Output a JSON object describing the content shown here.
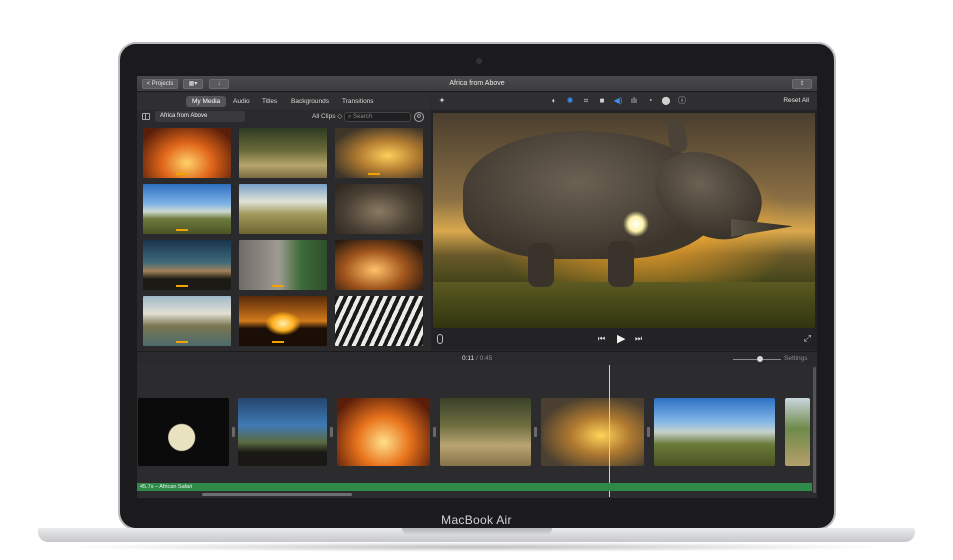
{
  "device": {
    "model_label": "MacBook Air"
  },
  "window": {
    "title": "Africa from Above",
    "projects_button": "< Projects",
    "layout_icon": "layout-icon",
    "import_icon": "import-arrow-icon",
    "share_icon": "share-icon"
  },
  "browser": {
    "tabs": [
      "My Media",
      "Audio",
      "Titles",
      "Backgrounds",
      "Transitions"
    ],
    "active_tab": "My Media",
    "event_name": "Africa from Above",
    "clip_filter": "All Clips ◇",
    "search_placeholder": "Search",
    "thumbnails": [
      "fire-flames",
      "lion-grass",
      "rhino-sunset",
      "zebra-herd",
      "giraffes-savanna",
      "rhino-closeup",
      "silhouette-dusk",
      "elephant-feeding",
      "sunset-tree",
      "zebras-waterhole",
      "sun-horizon",
      "zebra-portrait"
    ]
  },
  "viewer": {
    "reset_all": "Reset All",
    "adjust_icons": [
      "magic-wand-icon",
      "color-balance-icon",
      "color-correction-icon",
      "crop-icon",
      "stabilization-icon",
      "volume-icon",
      "equalizer-icon",
      "speed-icon",
      "noise-reduction-icon",
      "info-icon"
    ],
    "active_adjust": "volume-icon",
    "controls": {
      "skip_back": "⏮",
      "play": "▶",
      "skip_forward": "⏭",
      "fullscreen": "⤢"
    }
  },
  "timeline": {
    "current_time": "0:11",
    "separator": "/",
    "total_time": "0:45",
    "settings_label": "Settings",
    "audio_track_label": "45.7s – African Safari",
    "clips": [
      "moon-night",
      "jeep-passengers",
      "fire-flames",
      "lion-grass",
      "rhino-sunset",
      "zebra-herd",
      "tree-edge"
    ]
  },
  "colors": {
    "accent_blue": "#3b8ff5",
    "audio_green": "#2f8a4a",
    "clip_marker": "#f0a400"
  }
}
